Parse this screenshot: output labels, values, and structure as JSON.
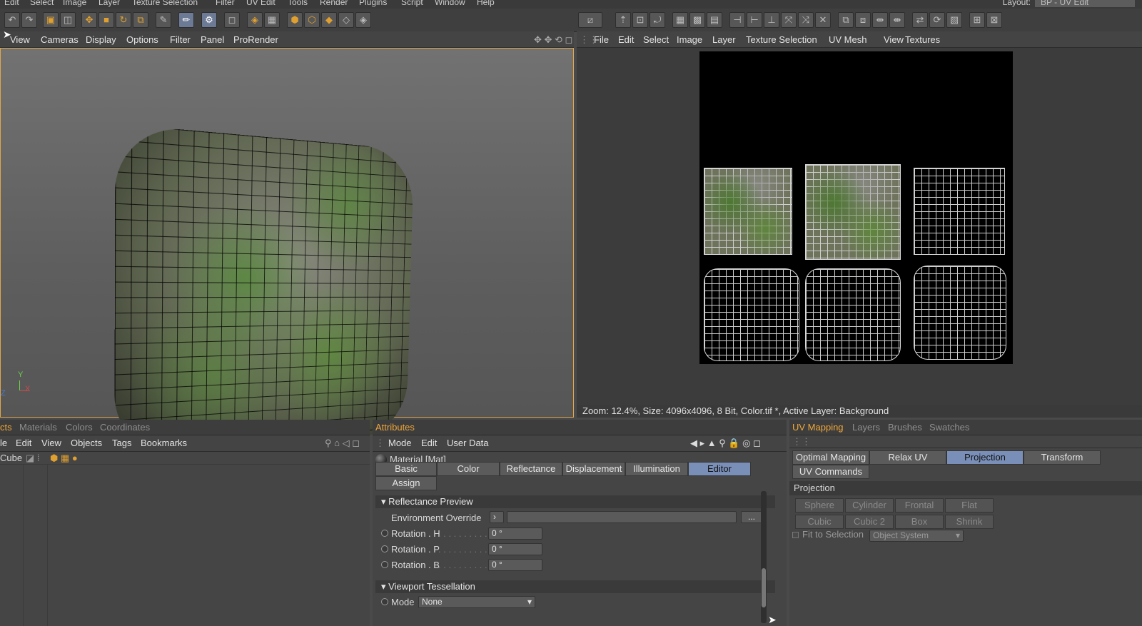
{
  "top_menu": [
    "Edit",
    "Select",
    "Image",
    "Layer",
    "Texture Selection",
    "Filter",
    "UV Edit",
    "Tools",
    "Render",
    "Plugins",
    "Script",
    "Window",
    "Help"
  ],
  "layout": {
    "label": "Layout:",
    "value": "BP - UV Edit"
  },
  "viewport": {
    "menu": [
      "View",
      "Cameras",
      "Display",
      "Options",
      "Filter",
      "Panel",
      "ProRender"
    ],
    "axis": {
      "y": "Y",
      "x": "X",
      "z": "Z"
    }
  },
  "uv_editor": {
    "menu": [
      "File",
      "Edit",
      "Select",
      "Image",
      "Layer",
      "Texture Selection",
      "UV Mesh",
      "View",
      "Textures"
    ],
    "status": "Zoom: 12.4%, Size: 4096x4096, 8 Bit, Color.tif *, Active Layer: Background"
  },
  "objects_panel": {
    "tabs": [
      "cts",
      "Materials",
      "Colors",
      "Coordinates"
    ],
    "menu": [
      "le",
      "Edit",
      "View",
      "Objects",
      "Tags",
      "Bookmarks"
    ],
    "row": {
      "name": "Cube"
    }
  },
  "attributes_panel": {
    "title": "Attributes",
    "menu": [
      "Mode",
      "Edit",
      "User Data"
    ],
    "material": "Material [Mat]",
    "tabs": [
      "Basic",
      "Color",
      "Reflectance",
      "Displacement",
      "Illumination",
      "Editor"
    ],
    "active_tab": "Editor",
    "assign": "Assign",
    "section1": "Reflectance Preview",
    "env_override": "Environment Override",
    "env_button": "...",
    "rot_h": "Rotation . H",
    "rot_p": "Rotation . P",
    "rot_b": "Rotation . B",
    "rot_h_val": "0 °",
    "rot_p_val": "0 °",
    "rot_b_val": "0 °",
    "section2": "Viewport Tessellation",
    "mode_label": "Mode",
    "mode_value": "None"
  },
  "uv_panel": {
    "tabs": [
      "UV Mapping",
      "Layers",
      "Brushes",
      "Swatches"
    ],
    "buttons": [
      "Optimal Mapping",
      "Relax UV",
      "Projection",
      "Transform"
    ],
    "uv_commands": "UV Commands",
    "section": "Projection",
    "proj_buttons": [
      "Sphere",
      "Cylinder",
      "Frontal",
      "Flat",
      "Cubic",
      "Cubic 2",
      "Box",
      "Shrink"
    ],
    "fit_label": "Fit to Selection",
    "fit_value": "Object System"
  },
  "colors": {
    "accent": "#f0a838",
    "selected": "#7a8fb8"
  }
}
